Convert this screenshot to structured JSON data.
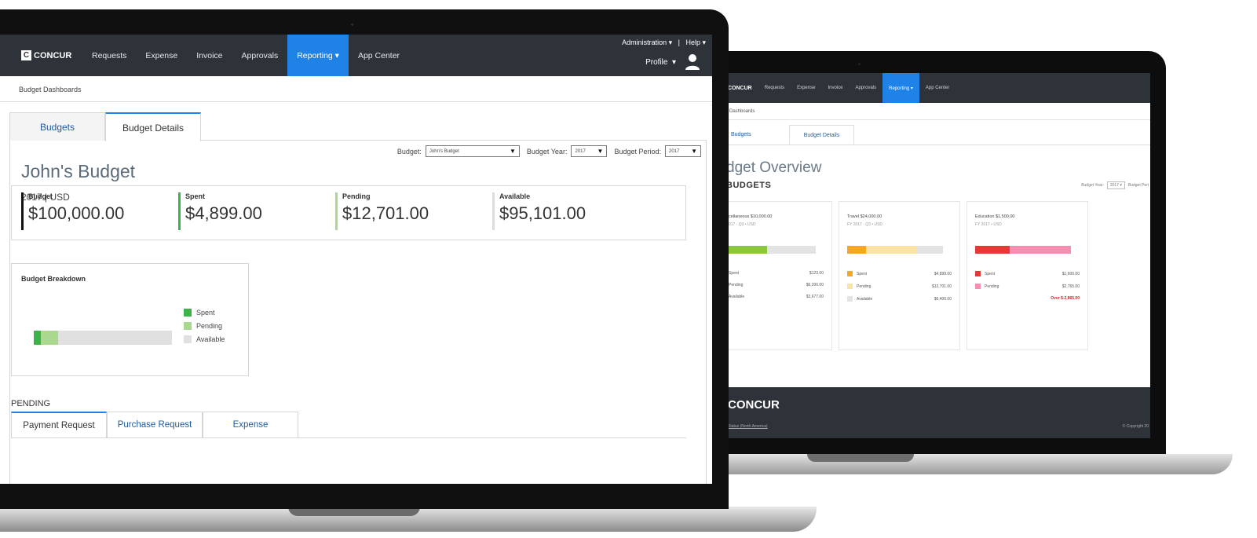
{
  "front": {
    "nav": {
      "brand": "CONCUR",
      "brand_mark": "C",
      "items": [
        "Requests",
        "Expense",
        "Invoice",
        "Approvals",
        "Reporting ▾",
        "App Center"
      ],
      "active_item": "Reporting ▾",
      "admin": "Administration ▾   |   Help ▾",
      "profile": "Profile  ▾"
    },
    "breadcrumb": "Budget Dashboards",
    "tabs": [
      "Budgets",
      "Budget Details"
    ],
    "active_tab": "Budget Details",
    "title": "John's Budget",
    "subtitle": "2017 | USD",
    "selectors": {
      "budget_label": "Budget:",
      "budget_value": "John's Budget",
      "year_label": "Budget Year:",
      "year_value": "2017",
      "period_label": "Budget Period:",
      "period_value": "2017"
    },
    "summary": [
      {
        "label": "Budget",
        "value": "$100,000.00",
        "color": "#111111"
      },
      {
        "label": "Spent",
        "value": "$4,899.00",
        "color": "#3cb34a"
      },
      {
        "label": "Pending",
        "value": "$12,701.00",
        "color": "#a9d88e"
      },
      {
        "label": "Available",
        "value": "$95,101.00",
        "color": "#dddddd"
      }
    ],
    "breakdown": {
      "title": "Budget Breakdown",
      "spent_fraction": 0.049,
      "pending_fraction": 0.127,
      "legend": [
        {
          "label": "Spent",
          "color": "#3cb34a"
        },
        {
          "label": "Pending",
          "color": "#a9d88e"
        },
        {
          "label": "Available",
          "color": "#e0e0e0"
        }
      ]
    },
    "pending_heading": "PENDING",
    "pending_tabs": [
      "Payment Request",
      "Purchase Request",
      "Expense"
    ],
    "active_pending_tab": "Payment Request"
  },
  "back": {
    "nav": {
      "brand": "CONCUR",
      "items": [
        "Requests",
        "Expense",
        "Invoice",
        "Approvals",
        "Reporting ▾",
        "App Center"
      ]
    },
    "breadcrumb": "Dashboards",
    "tabs": [
      "Budgets",
      "Budget Details"
    ],
    "title": "dget Overview",
    "section": "BUDGETS",
    "year_label": "Budget Year:",
    "year_value": "2017 ▾",
    "period_label": "Budget Peri",
    "cards": [
      {
        "title": "cellaneous $10,000.00",
        "sub": "017 · Q3 • USD",
        "bar": [
          {
            "f": 0.44,
            "c": "#8cc63f"
          },
          {
            "f": 0.56,
            "c": "#e3e3e3"
          }
        ],
        "rows": [
          {
            "k": "Spent",
            "v": "$123.00",
            "c": ""
          },
          {
            "k": "Pending",
            "v": "$6,200.00",
            "c": ""
          },
          {
            "k": "Available",
            "v": "$3,677.00",
            "c": ""
          }
        ],
        "over": ""
      },
      {
        "title": "Travel $24,000.00",
        "sub": "FY 2017 · Q3 • USD",
        "bar": [
          {
            "f": 0.2,
            "c": "#f5a623"
          },
          {
            "f": 0.52,
            "c": "#fbe3a4"
          },
          {
            "f": 0.28,
            "c": "#e3e3e3"
          }
        ],
        "rows": [
          {
            "k": "Spent",
            "v": "$4,899.00",
            "c": "#f5a623"
          },
          {
            "k": "Pending",
            "v": "$12,701.00",
            "c": "#fbe3a4"
          },
          {
            "k": "Available",
            "v": "$6,400.00",
            "c": "#e3e3e3"
          }
        ],
        "over": ""
      },
      {
        "title": "Education $1,500.00",
        "sub": "FY 2017 • USD",
        "bar": [
          {
            "f": 0.36,
            "c": "#e53935"
          },
          {
            "f": 0.64,
            "c": "#f48fb1"
          }
        ],
        "rows": [
          {
            "k": "Spent",
            "v": "$1,600.00",
            "c": "#e53935"
          },
          {
            "k": "Pending",
            "v": "$2,765.00",
            "c": "#f48fb1"
          }
        ],
        "over": "Over $-2,865.00"
      }
    ],
    "footer": {
      "brand": "CONCUR",
      "link": "Status (North America)",
      "copy": "© Copyright 20"
    }
  }
}
